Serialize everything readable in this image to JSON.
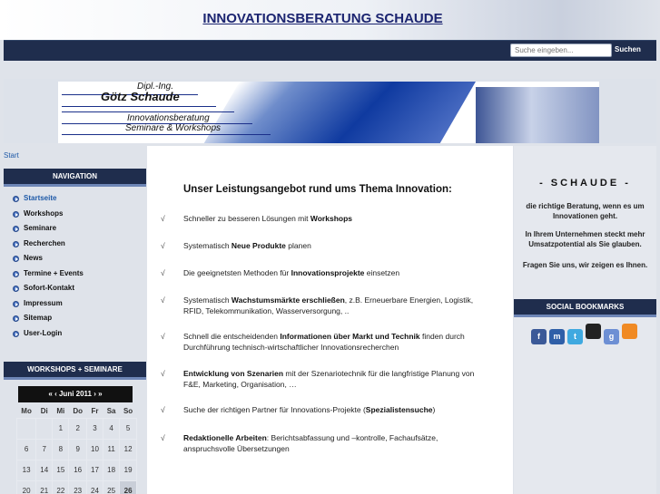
{
  "header": {
    "site_title": "INNOVATIONSBERATUNG SCHAUDE"
  },
  "search": {
    "placeholder": "Suche eingeben...",
    "button": "Suchen"
  },
  "banner": {
    "title": "Dipl.-Ing.",
    "name": "Götz Schaude",
    "line1": "Innovationsberatung",
    "line2": "Seminare & Workshops"
  },
  "breadcrumb": "Start",
  "navigation": {
    "heading": "NAVIGATION",
    "items": [
      {
        "label": "Startseite",
        "active": true
      },
      {
        "label": "Workshops"
      },
      {
        "label": "Seminare"
      },
      {
        "label": "Recherchen"
      },
      {
        "label": "News"
      },
      {
        "label": "Termine + Events"
      },
      {
        "label": "Sofort-Kontakt"
      },
      {
        "label": "Impressum"
      },
      {
        "label": "Sitemap"
      },
      {
        "label": "User-Login"
      }
    ]
  },
  "calendar": {
    "heading": "WORKSHOPS + SEMINARE",
    "prev_year": "«",
    "prev_month": "‹",
    "month_label": "Juni 2011",
    "next_month": "›",
    "next_year": "»",
    "weekdays": [
      "Mo",
      "Di",
      "Mi",
      "Do",
      "Fr",
      "Sa",
      "So"
    ],
    "weeks": [
      [
        "",
        "",
        "1",
        "2",
        "3",
        "4",
        "5"
      ],
      [
        "6",
        "7",
        "8",
        "9",
        "10",
        "11",
        "12"
      ],
      [
        "13",
        "14",
        "15",
        "16",
        "17",
        "18",
        "19"
      ],
      [
        "20",
        "21",
        "22",
        "23",
        "24",
        "25",
        "26"
      ]
    ],
    "today": "26"
  },
  "main": {
    "title": "Unser Leistungsangebot rund ums Thema Innovation:",
    "check_symbol": "√",
    "services": [
      {
        "pre": "Schneller zu besseren Lösungen mit ",
        "bold": "Workshops",
        "post": ""
      },
      {
        "pre": "Systematisch ",
        "bold": "Neue Produkte",
        "post": " planen"
      },
      {
        "pre": "Die geeignetsten Methoden für ",
        "bold": "Innovationsprojekte",
        "post": " einsetzen"
      },
      {
        "pre": "Systematisch ",
        "bold": "Wachstumsmärkte erschließen",
        "post": ", z.B. Erneuerbare Energien, Logistik, RFID, Telekommunikation, Wasserversorgung, .."
      },
      {
        "pre": "Schnell die entscheidenden ",
        "bold": "Informationen über Markt und Technik",
        "post": " finden durch Durchführung technisch-wirtschaftlicher Innovationsrecherchen"
      },
      {
        "pre": "",
        "bold": "Entwicklung von Szenarien",
        "post": " mit der Szenariotechnik für die langfristige Planung von F&E, Marketing, Organisation, …"
      },
      {
        "pre": "Suche der richtigen Partner für Innovations-Projekte (",
        "bold": "Spezialistensuche",
        "post": ")"
      },
      {
        "pre": "",
        "bold": "Redaktionelle Arbeiten",
        "post": ": Berichtsabfassung und –kontrolle, Fachaufsätze, anspruchsvolle Übersetzungen"
      }
    ]
  },
  "sidebar": {
    "title": "- SCHAUDE -",
    "p1": "die richtige Beratung, wenn es um Innovationen geht.",
    "p2": "In Ihrem Unternehmen steckt mehr Umsatzpotential als Sie glauben.",
    "p3": "Fragen Sie uns, wir zeigen es Ihnen.",
    "social_heading": "SOCIAL BOOKMARKS",
    "social": [
      {
        "icon": "facebook-icon",
        "glyph": "f",
        "color": "#3b5998"
      },
      {
        "icon": "myspace-icon",
        "glyph": "m",
        "color": "#2f5fa8"
      },
      {
        "icon": "twitter-icon",
        "glyph": "t",
        "color": "#3fa9e0"
      },
      {
        "icon": "delicious-icon",
        "glyph": "",
        "color": "#222222"
      },
      {
        "icon": "google-icon",
        "glyph": "g",
        "color": "#6d8fd4"
      },
      {
        "icon": "rss-icon",
        "glyph": "",
        "color": "#f08a24"
      }
    ]
  }
}
